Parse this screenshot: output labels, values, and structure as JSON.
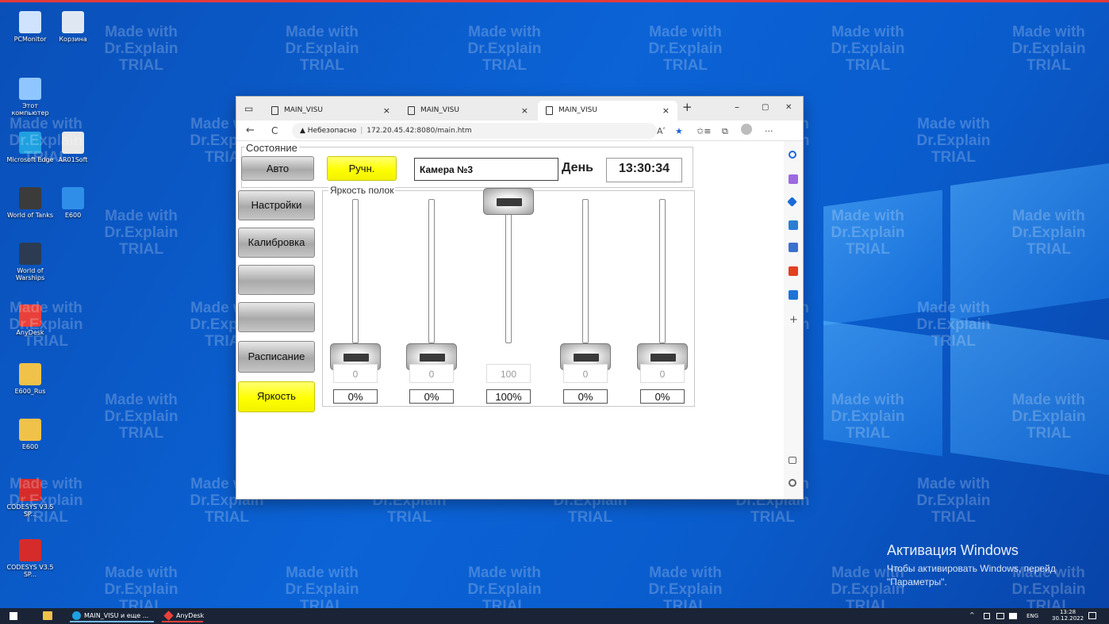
{
  "desktop": {
    "icons": [
      {
        "label": "PCMonitor",
        "icon": "monitor-icon",
        "color": "#cfe3ff"
      },
      {
        "label": "Корзина",
        "icon": "recycle-bin-icon",
        "color": "#dfe8f2"
      },
      {
        "label": "Этот компьютер",
        "icon": "computer-icon",
        "color": "#8fc6ff"
      },
      {
        "label": "Microsoft Edge",
        "icon": "edge-icon",
        "color": "#1fa0e0"
      },
      {
        "label": "AR01Soft",
        "icon": "folder-icon",
        "color": "#e8e8e8"
      },
      {
        "label": "World of Tanks",
        "icon": "world-of-tanks-icon",
        "color": "#3b3b3b"
      },
      {
        "label": "E600",
        "icon": "ie-icon",
        "color": "#2f8fe8"
      },
      {
        "label": "World of Warships",
        "icon": "world-of-warships-icon",
        "color": "#2c3b52"
      },
      {
        "label": "AnyDesk",
        "icon": "anydesk-icon",
        "color": "#e8403a"
      },
      {
        "label": "E600_Rus",
        "icon": "folder-icon",
        "color": "#f0c24a"
      },
      {
        "label": "E600",
        "icon": "folder-icon",
        "color": "#f0c24a"
      },
      {
        "label": "CODESYS V3.5 SP...",
        "icon": "codesys-icon",
        "color": "#d62b2b"
      },
      {
        "label": "CODESYS V3.5 SP...",
        "icon": "codesys-icon",
        "color": "#d62b2b"
      }
    ],
    "watermark": [
      "Made with",
      "Dr.Explain",
      "TRIAL"
    ]
  },
  "browser": {
    "tabs": [
      {
        "title": "MAIN_VISU",
        "close": "×"
      },
      {
        "title": "MAIN_VISU",
        "close": "×"
      },
      {
        "title": "MAIN_VISU",
        "close": "×"
      }
    ],
    "new_tab": "+",
    "window_controls": {
      "minimize": "–",
      "maximize": "▢",
      "close": "✕"
    },
    "nav": {
      "back": "←",
      "reload": "C"
    },
    "address": {
      "security_label": "▲ Небезопасно",
      "url": "172.20.45.42:8080/main.htm"
    },
    "toolbar": {
      "read_aloud": "Aʹ",
      "favorite": "★",
      "favorites": "✩≡",
      "collections": "⧉",
      "more": "···"
    }
  },
  "hmi": {
    "state_group_label": "Состояние",
    "mode_auto": "Авто",
    "mode_manual": "Ручн.",
    "camera_name": "Камера №3",
    "day_label": "День",
    "clock": "13:30:34",
    "menu": {
      "settings": "Настройки",
      "calibration": "Калибровка",
      "blank1": "",
      "blank2": "",
      "schedule": "Расписание",
      "brightness": "Яркость"
    },
    "brightness_group_label": "Яркость полок",
    "sliders": [
      {
        "value": "0",
        "percent": "0%",
        "level": 0
      },
      {
        "value": "0",
        "percent": "0%",
        "level": 0
      },
      {
        "value": "100",
        "percent": "100%",
        "level": 1
      },
      {
        "value": "0",
        "percent": "0%",
        "level": 0
      },
      {
        "value": "0",
        "percent": "0%",
        "level": 0
      }
    ]
  },
  "activation": {
    "title": "Активация Windows",
    "line1": "Чтобы активировать Windows, перейд",
    "line2": "\"Параметры\"."
  },
  "taskbar": {
    "start_icon": "windows-start-icon",
    "items": [
      {
        "label": "MAIN_VISU и еще ...",
        "icon": "edge-icon"
      },
      {
        "label": "AnyDesk",
        "icon": "anydesk-icon"
      }
    ],
    "tray": {
      "chevron": "^",
      "lang": "ENG",
      "time": "13:28",
      "date": "30.12.2022"
    }
  },
  "colors": {
    "accent_yellow": "#ffff00",
    "button_gray": "#a9a9a9",
    "desktop_blue": "#0b63d6"
  }
}
